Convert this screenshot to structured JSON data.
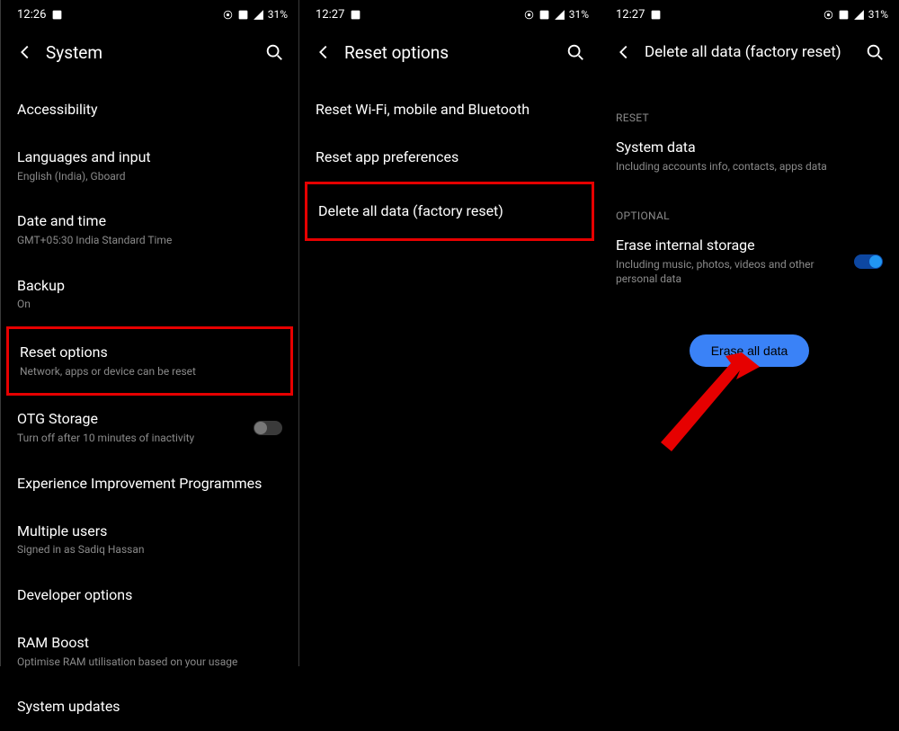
{
  "pane1": {
    "time": "12:26",
    "battery": "31%",
    "title": "System",
    "items": [
      {
        "title": "Accessibility",
        "sub": ""
      },
      {
        "title": "Languages and input",
        "sub": "English (India), Gboard"
      },
      {
        "title": "Date and time",
        "sub": "GMT+05:30 India Standard Time"
      },
      {
        "title": "Backup",
        "sub": "On"
      },
      {
        "title": "Reset options",
        "sub": "Network, apps or device can be reset"
      },
      {
        "title": "OTG Storage",
        "sub": "Turn off after 10 minutes of inactivity"
      },
      {
        "title": "Experience Improvement Programmes",
        "sub": ""
      },
      {
        "title": "Multiple users",
        "sub": "Signed in as Sadiq Hassan"
      },
      {
        "title": "Developer options",
        "sub": ""
      },
      {
        "title": "RAM Boost",
        "sub": "Optimise RAM utilisation based on your usage"
      },
      {
        "title": "System updates",
        "sub": ""
      }
    ]
  },
  "pane2": {
    "time": "12:27",
    "battery": "31%",
    "title": "Reset options",
    "items": [
      {
        "title": "Reset Wi-Fi, mobile and Bluetooth"
      },
      {
        "title": "Reset app preferences"
      },
      {
        "title": "Delete all data (factory reset)"
      }
    ]
  },
  "pane3": {
    "time": "12:27",
    "battery": "31%",
    "title": "Delete all data (factory reset)",
    "reset_header": "RESET",
    "system_data": {
      "title": "System data",
      "sub": "Including accounts info, contacts, apps data"
    },
    "optional_header": "OPTIONAL",
    "erase_storage": {
      "title": "Erase internal storage",
      "sub": "Including music, photos, videos and other personal data"
    },
    "erase_button": "Erase all data"
  }
}
